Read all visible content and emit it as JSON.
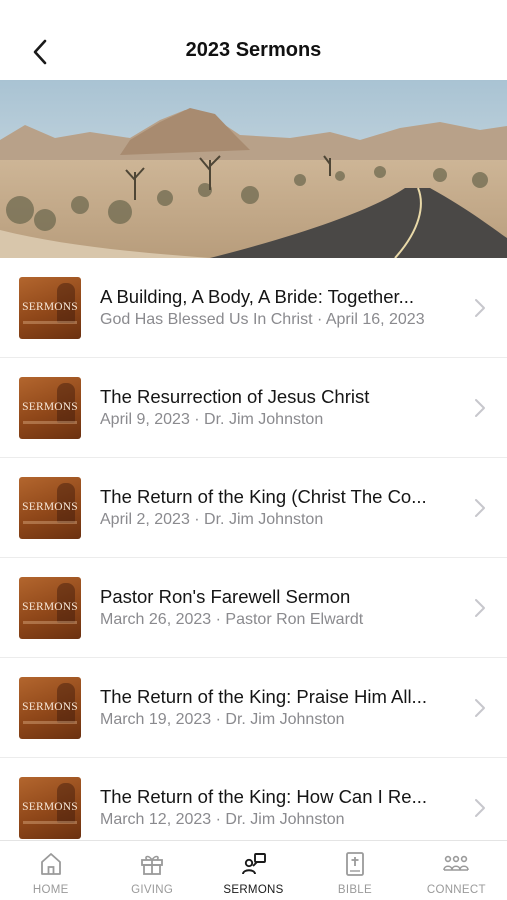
{
  "header": {
    "title": "2023 Sermons",
    "back_icon": "chevron-left-icon"
  },
  "hero": {
    "image": "desert-road-landscape"
  },
  "thumbnail_label": "SERMONS",
  "sermons": [
    {
      "title": "A Building, A Body, A Bride: Together...",
      "subtitle": "God Has Blessed Us In Christ · April 16, 2023"
    },
    {
      "title": "The Resurrection of Jesus Christ",
      "subtitle": "April 9, 2023 · Dr. Jim Johnston"
    },
    {
      "title": "The Return of the King (Christ The Co...",
      "subtitle": "April 2, 2023 · Dr. Jim Johnston"
    },
    {
      "title": "Pastor Ron's Farewell Sermon",
      "subtitle": "March 26, 2023 · Pastor Ron Elwardt"
    },
    {
      "title": "The Return of the King: Praise Him All...",
      "subtitle": "March 19, 2023 · Dr. Jim Johnston"
    },
    {
      "title": "The Return of the King: How Can I Re...",
      "subtitle": "March 12, 2023 · Dr. Jim Johnston"
    }
  ],
  "tabbar": {
    "items": [
      {
        "label": "HOME",
        "icon": "home-icon",
        "active": false
      },
      {
        "label": "GIVING",
        "icon": "gift-icon",
        "active": false
      },
      {
        "label": "SERMONS",
        "icon": "sermons-icon",
        "active": true
      },
      {
        "label": "BIBLE",
        "icon": "bible-icon",
        "active": false
      },
      {
        "label": "CONNECT",
        "icon": "connect-icon",
        "active": false
      }
    ]
  },
  "colors": {
    "active_tab": "#1a1a1a",
    "inactive_tab": "#9a9a9a",
    "subtitle": "#8a8a8e",
    "thumbnail": "#a0522d"
  }
}
